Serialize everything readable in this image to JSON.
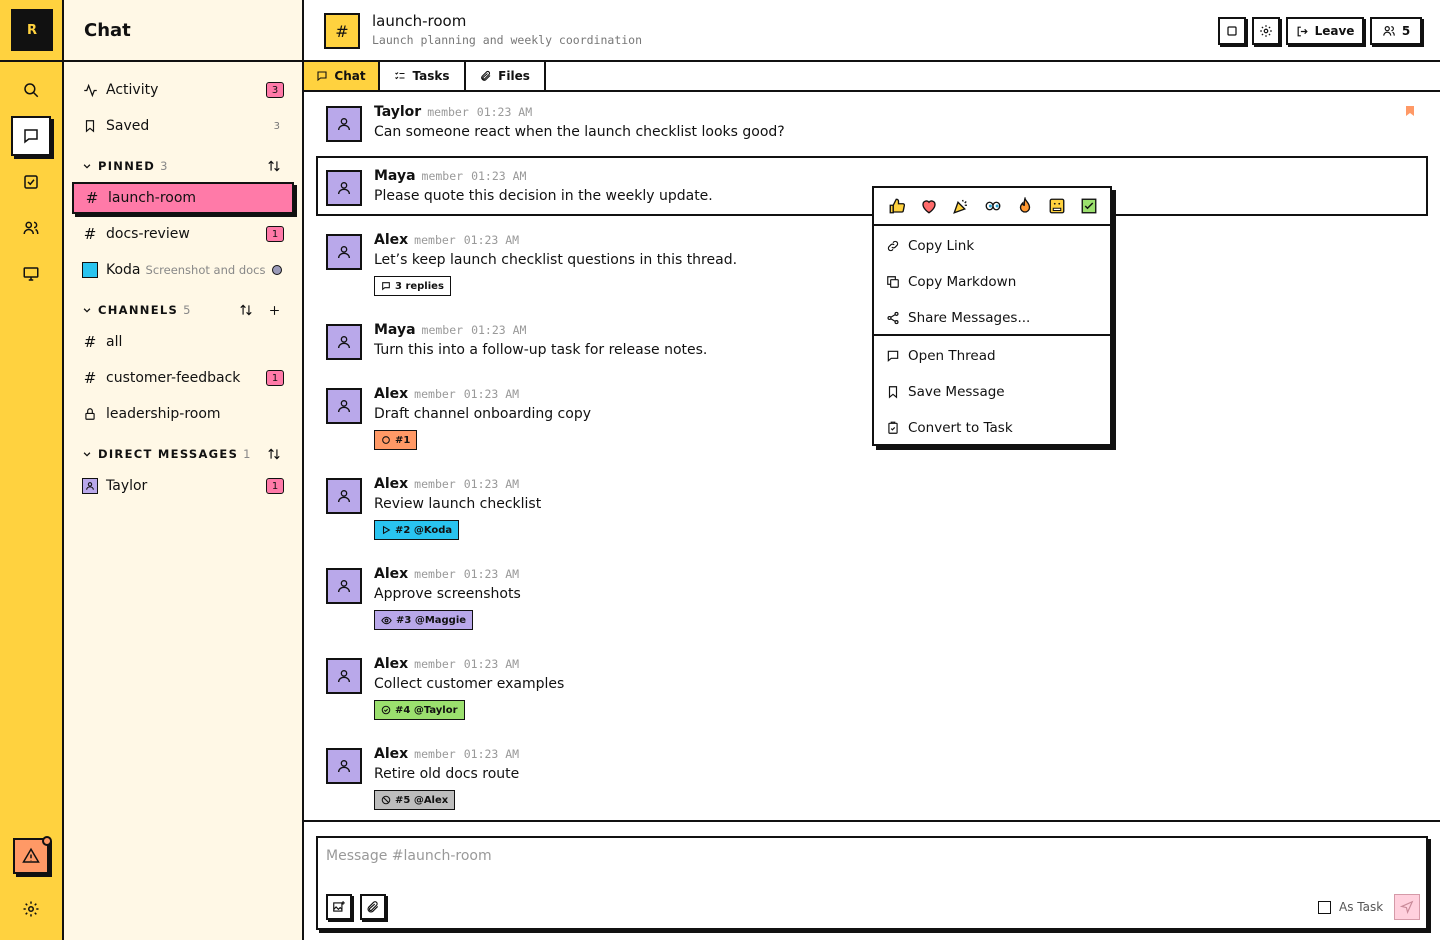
{
  "rail": {
    "logo": "R",
    "items": [
      "search",
      "chat",
      "tasks",
      "people",
      "desktop"
    ],
    "active": "chat"
  },
  "sidebar": {
    "title": "Chat",
    "activity": {
      "label": "Activity",
      "count": "3"
    },
    "saved": {
      "label": "Saved",
      "count": "3"
    },
    "pinned": {
      "label": "PINNED",
      "count": "3",
      "items": [
        {
          "label": "launch-room",
          "badge": ""
        },
        {
          "label": "docs-review",
          "badge": "1"
        },
        {
          "label": "Koda",
          "sub": "Screenshot and docs"
        }
      ]
    },
    "channels": {
      "label": "CHANNELS",
      "count": "5",
      "items": [
        {
          "label": "all",
          "badge": ""
        },
        {
          "label": "customer-feedback",
          "badge": "1"
        },
        {
          "label": "leadership-room",
          "badge": ""
        }
      ]
    },
    "dms": {
      "label": "DIRECT MESSAGES",
      "count": "1",
      "items": [
        {
          "label": "Taylor",
          "badge": "1"
        }
      ]
    }
  },
  "header": {
    "channel_icon": "#",
    "title": "launch-room",
    "description": "Launch planning and weekly coordination",
    "leave_label": "Leave",
    "members_count": "5"
  },
  "tabs": [
    {
      "label": "Chat"
    },
    {
      "label": "Tasks"
    },
    {
      "label": "Files"
    }
  ],
  "messages": [
    {
      "author": "Taylor",
      "role": "member",
      "time": "01:23 AM",
      "text": "Can someone react when the launch checklist looks good?"
    },
    {
      "author": "Maya",
      "role": "member",
      "time": "01:23 AM",
      "text": "Please quote this decision in the weekly update."
    },
    {
      "author": "Alex",
      "role": "member",
      "time": "01:23 AM",
      "text": "Let’s keep launch checklist questions in this thread.",
      "chip": "3 replies"
    },
    {
      "author": "Maya",
      "role": "member",
      "time": "01:23 AM",
      "text": "Turn this into a follow-up task for release notes."
    },
    {
      "author": "Alex",
      "role": "member",
      "time": "01:23 AM",
      "text": "Draft channel onboarding copy",
      "chip": "#1",
      "chip_color": "#ff9966"
    },
    {
      "author": "Alex",
      "role": "member",
      "time": "01:23 AM",
      "text": "Review launch checklist",
      "chip": "#2 @Koda",
      "chip_color": "#29c4f0"
    },
    {
      "author": "Alex",
      "role": "member",
      "time": "01:23 AM",
      "text": "Approve screenshots",
      "chip": "#3 @Maggie",
      "chip_color": "#b9a8ea"
    },
    {
      "author": "Alex",
      "role": "member",
      "time": "01:23 AM",
      "text": "Collect customer examples",
      "chip": "#4 @Taylor",
      "chip_color": "#9be06e"
    },
    {
      "author": "Alex",
      "role": "member",
      "time": "01:23 AM",
      "text": "Retire old docs route",
      "chip": "#5 @Alex",
      "chip_color": "#bdbdbd"
    }
  ],
  "context_menu": {
    "reactions": [
      "thumbs-up",
      "heart",
      "party",
      "eyes",
      "fire",
      "grimace",
      "check"
    ],
    "items": [
      {
        "label": "Copy Link"
      },
      {
        "label": "Copy Markdown"
      },
      {
        "label": "Share Messages..."
      },
      {
        "label": "Open Thread"
      },
      {
        "label": "Save Message"
      },
      {
        "label": "Convert to Task"
      }
    ]
  },
  "composer": {
    "placeholder": "Message #launch-room",
    "as_task_label": "As Task"
  },
  "colors": {
    "yellow": "#ffd23f",
    "pink": "#ff7aa8",
    "cream": "#fff8e6",
    "purple": "#b9a8ea",
    "orange": "#ff9966"
  }
}
